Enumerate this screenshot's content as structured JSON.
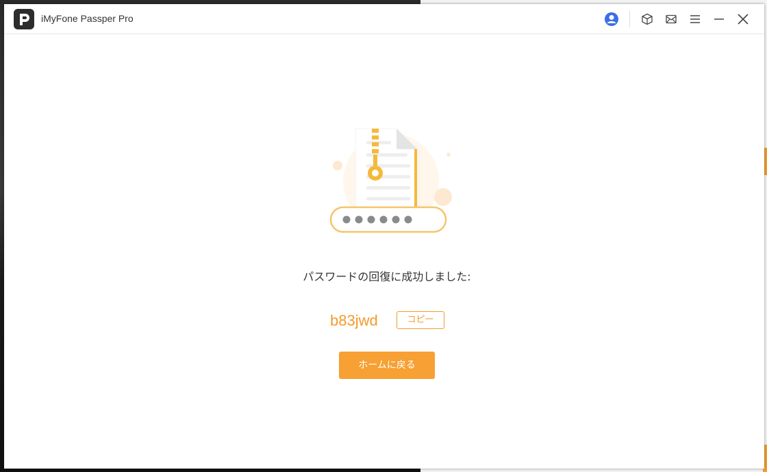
{
  "app": {
    "title": "iMyFone Passper Pro"
  },
  "titlebar": {
    "icons": [
      "user-icon",
      "box-icon",
      "mail-icon",
      "menu-icon",
      "minimize-icon",
      "close-icon"
    ]
  },
  "result": {
    "message": "パスワードの回復に成功しました:",
    "password": "b83jwd",
    "copy_label": "コピー",
    "home_label": "ホームに戻る"
  },
  "colors": {
    "accent": "#f39a2b",
    "button": "#f7a033",
    "user_icon": "#3d6ee8"
  }
}
